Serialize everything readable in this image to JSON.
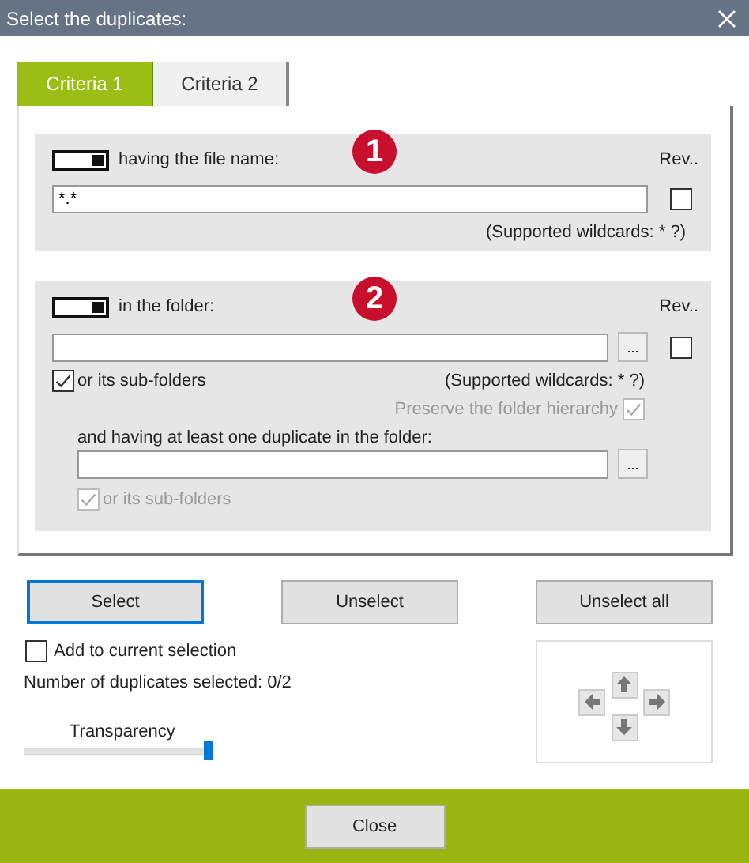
{
  "window": {
    "title": "Select the duplicates:"
  },
  "tabs": [
    {
      "label": "Criteria 1",
      "selected": true
    },
    {
      "label": "Criteria 2",
      "selected": false
    }
  ],
  "file_name_section": {
    "badge": "1",
    "toggle_on": true,
    "label": "having the file name:",
    "reverse": {
      "label": "Rev..",
      "checked": false
    },
    "field_value": "*.*",
    "hint": "(Supported wildcards: * ?)"
  },
  "folder_section": {
    "badge": "2",
    "toggle_on": true,
    "label": "in the folder:",
    "reverse": {
      "label": "Rev..",
      "checked": false
    },
    "browse": "...",
    "subfolders": {
      "label": "or its sub-folders",
      "checked": true,
      "disabled": false
    },
    "hint": "(Supported wildcards: * ?)",
    "preserve": {
      "label": "Preserve the folder hierarchy",
      "checked": true,
      "disabled": true
    },
    "second_label": "and having at least one duplicate in the folder:",
    "second_browse": "...",
    "second_subfolders": {
      "label": "or its sub-folders",
      "checked": true,
      "disabled": true
    }
  },
  "buttons": [
    {
      "label": "Select",
      "focused": true
    },
    {
      "label": "Unselect",
      "focused": false
    },
    {
      "label": "Unselect all",
      "focused": false
    }
  ],
  "add_to_selection": {
    "label": "Add to current selection",
    "checked": false
  },
  "count": "Number of duplicates selected: 0/2",
  "transparency": {
    "label": "Transparency",
    "level": 1
  },
  "close": "Close"
}
